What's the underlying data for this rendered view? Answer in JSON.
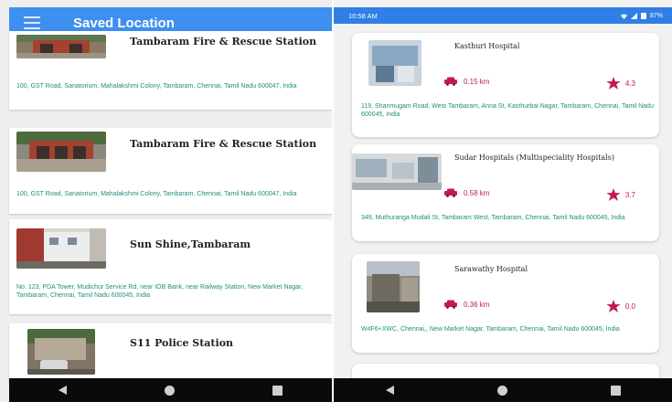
{
  "left": {
    "appbar_title": "Saved Location",
    "locations": [
      {
        "name": "Tambaram Fire & Rescue Station",
        "address": "100, GST Road, Sanatorium, Mahalakshmi Colony, Tambaram, Chennai, Tamil Nadu 600047, India",
        "thumb_icon": "fire-station-photo"
      },
      {
        "name": "Tambaram Fire & Rescue Station",
        "address": "100, GST Road, Sanatorium, Mahalakshmi Colony, Tambaram, Chennai, Tamil Nadu 600047, India",
        "thumb_icon": "fire-station-photo"
      },
      {
        "name": "Sun Shine,Tambaram",
        "address": "No. 123, PDA Tower, Mudichur Service Rd, near IOB Bank, near Railway Station, New Market Nagar, Tambaram, Chennai, Tamil Nadu 600045, India",
        "thumb_icon": "building-photo"
      },
      {
        "name": "S11 Police Station",
        "address": "",
        "thumb_icon": "police-station-photo"
      }
    ]
  },
  "right": {
    "status_time": "10:58 AM",
    "battery": "87%",
    "hospitals": [
      {
        "name": "Kasthuri Hospital",
        "distance": "0.15 km",
        "rating": "4.3",
        "address": "119, Shanmugam Road, West Tambaram, Anna St, Kasthurbai Nagar, Tambaram, Chennai, Tamil Nadu 600045, India"
      },
      {
        "name": "Sudar Hospitals (Multispeciality Hospitals)",
        "distance": "0.58 km",
        "rating": "3.7",
        "address": "349, Muthuranga Mudali St, Tambaram West, Tambaram, Chennai, Tamil Nadu 600045, India"
      },
      {
        "name": "Sarawathy Hospital",
        "distance": "0.36 km",
        "rating": "0.0",
        "address": "W4F6+XWC, Chennai,, New Market Nagar, Tambaram, Chennai, Tamil Nadu 600045, India"
      }
    ]
  },
  "colors": {
    "appbar": "#3d8ff0",
    "statusbar": "#2f7fe6",
    "address_text": "#1d8f7e",
    "accent": "#c2185b"
  }
}
